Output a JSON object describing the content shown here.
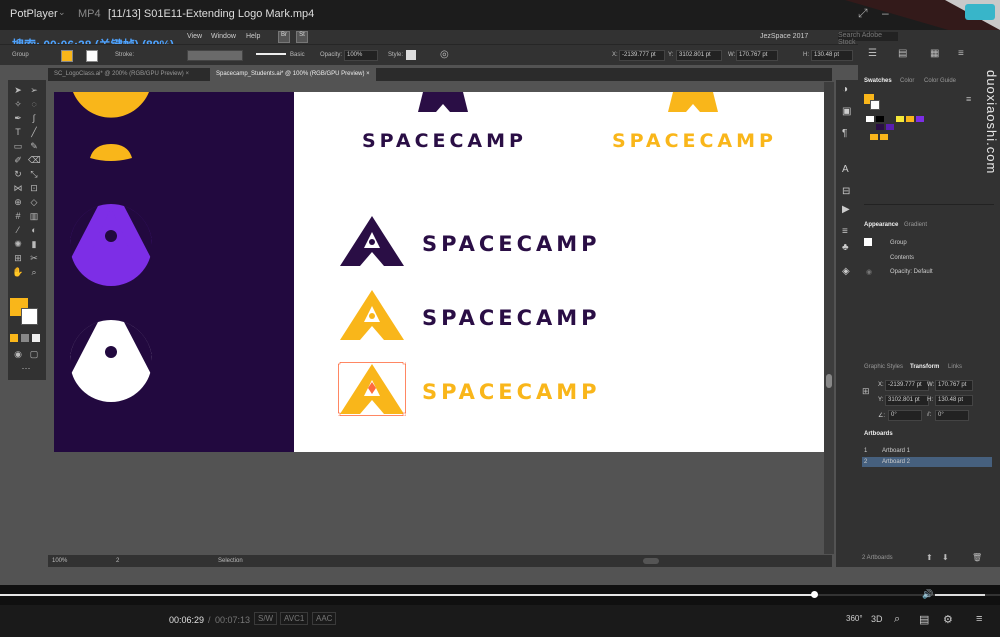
{
  "player": {
    "brand": "PotPlayer",
    "format": "MP4",
    "file_title": "[11/13] S01E11-Extending Logo Mark.mp4",
    "overlay": "搜索: 00:06:28 (关键帧) (89%)",
    "time_current": "00:06:29",
    "time_separator": "/",
    "time_total": "00:07:13",
    "codec_sw": "S/W",
    "codec_video": "AVC1",
    "codec_audio": "AAC",
    "btn_360": "360°",
    "btn_3d": "3D",
    "progress_fraction": 0.815
  },
  "watermark": "duoxiaoshi.com",
  "illustrator": {
    "menu": [
      "View",
      "Window",
      "Help"
    ],
    "workspace": "JezSpace 2017",
    "search_placeholder": "Search Adobe Stock",
    "control": {
      "group_label": "Group",
      "stroke_label": "Stroke:",
      "brush_label": "Basic",
      "opacity_label": "Opacity:",
      "opacity_value": "100%",
      "style_label": "Style:",
      "x_label": "X:",
      "x_value": "-2139.777 pt",
      "y_label": "Y:",
      "y_value": "3102.801 pt",
      "w_label": "W:",
      "w_value": "170.767 pt",
      "h_label": "H:",
      "h_value": "130.48 pt"
    },
    "tabs": [
      "SC_LogoClass.ai* @ 200% (RGB/GPU Preview)",
      "Spacecamp_Students.ai* @ 100% (RGB/GPU Preview)"
    ],
    "status": {
      "zoom": "100%",
      "artboard": "2",
      "tool": "Selection"
    },
    "logo_text": "SPACECAMP",
    "colors": {
      "navy": "#2a0e45",
      "yellow": "#f9b61a",
      "purple": "#7d2ee6",
      "dark_bg": "#22093f"
    },
    "panels": {
      "swatches_tabs": [
        "Swatches",
        "Color",
        "Color Guide"
      ],
      "appearance_tabs": [
        "Appearance",
        "Gradient"
      ],
      "appearance_rows": [
        "Group",
        "Contents",
        "Opacity: Default"
      ],
      "transform_tabs": [
        "Graphic Styles",
        "Transform",
        "Links"
      ],
      "transform": {
        "x": "-2139.777 pt",
        "y": "3102.801 pt",
        "w": "170.767 pt",
        "h": "130.48 pt",
        "angle": "0°",
        "shear": "0°"
      },
      "artboards_title": "Artboards",
      "artboards": [
        {
          "num": "1",
          "name": "Artboard 1"
        },
        {
          "num": "2",
          "name": "Artboard 2"
        }
      ],
      "artboards_count": "2 Artboards"
    }
  }
}
